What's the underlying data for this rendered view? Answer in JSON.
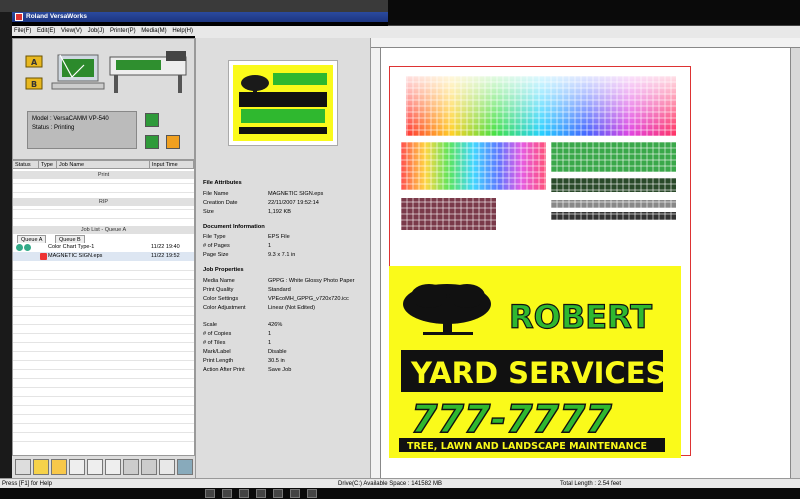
{
  "app": {
    "title": "Roland VersaWorks"
  },
  "menu": [
    "File(F)",
    "Edit(E)",
    "View(V)",
    "Job(J)",
    "Printer(P)",
    "Media(M)",
    "Help(H)"
  ],
  "printer": {
    "model_label": "Model : VersaCAMM VP-540",
    "status_label": "Status : Printing"
  },
  "job_table": {
    "headers": [
      "Status",
      "Type",
      "Job Name",
      "Input Time"
    ],
    "sections": {
      "print": "Print",
      "rip": "RIP",
      "job_list": "Job List - Queue A"
    },
    "tabs": [
      "Queue A",
      "Queue B"
    ],
    "jobs": [
      {
        "name": "Color Chart Type-1",
        "time": "11/22 19:40"
      },
      {
        "name": "MAGNETIC SIGN.eps",
        "time": "11/22 19:52"
      }
    ]
  },
  "attributes": {
    "file_section": "File Attributes",
    "file": [
      {
        "label": "File Name",
        "value": "MAGNETIC SIGN.eps"
      },
      {
        "label": "Creation Date",
        "value": "22/11/2007 19:52:14"
      },
      {
        "label": "Size",
        "value": "1,192 KB"
      }
    ],
    "doc_section": "Document Information",
    "doc": [
      {
        "label": "File Type",
        "value": "EPS File"
      },
      {
        "label": "# of Pages",
        "value": "1"
      },
      {
        "label": "Page Size",
        "value": "9.3 x 7.1 in"
      }
    ],
    "job_section": "Job Properties",
    "job": [
      {
        "label": "Media Name",
        "value": "GPPG : White Glossy Photo Paper"
      },
      {
        "label": "Print Quality",
        "value": "Standard"
      },
      {
        "label": "Color Settings",
        "value": "VPEcoMH_GPPG_v720x720.icc"
      },
      {
        "label": "Color Adjustment",
        "value": "Linear (Not Edited)"
      }
    ],
    "job2": [
      {
        "label": "Scale",
        "value": "426%"
      },
      {
        "label": "# of Copies",
        "value": "1"
      },
      {
        "label": "# of Tiles",
        "value": "1"
      },
      {
        "label": "Mark/Label",
        "value": "Disable"
      },
      {
        "label": "Print Length",
        "value": "30.5 in"
      },
      {
        "label": "Action After Print",
        "value": "Save Job"
      }
    ]
  },
  "sign": {
    "line1": "ROBERT",
    "line2": "YARD SERVICES",
    "line3": "777-7777",
    "line4": "TREE, LAWN AND LANDSCAPE MAINTENANCE"
  },
  "statusbar": {
    "help": "Press [F1] for Help",
    "drive": "Drive(C:) Available Space : 141582 MB",
    "length": "Total Length : 2.54 feet"
  },
  "colors": {
    "sign_yellow": "#fafa1a",
    "sign_green": "#2fb82f",
    "title_blue": "#1c3580"
  }
}
